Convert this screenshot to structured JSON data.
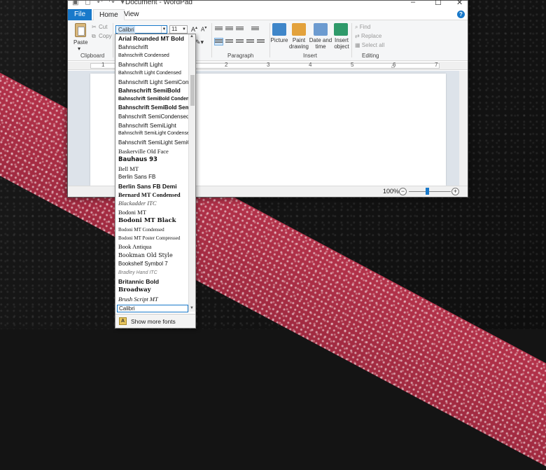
{
  "window": {
    "title": "Document - WordPad",
    "tabs": {
      "file": "File",
      "home": "Home",
      "view": "View"
    },
    "help": "?",
    "controls": {
      "minimize": "–",
      "maximize": "☐",
      "close": "✕"
    }
  },
  "ribbon": {
    "clipboard": {
      "label": "Clipboard",
      "paste": "Paste",
      "cut": "Cut",
      "copy": "Copy"
    },
    "font": {
      "current": "Calibri",
      "size": "11"
    },
    "paragraph": {
      "label": "Paragraph"
    },
    "insert": {
      "label": "Insert",
      "picture": "Picture",
      "paint_drawing": "Paint drawing",
      "date_time": "Date and time",
      "insert_object": "Insert object"
    },
    "editing": {
      "label": "Editing",
      "find": "Find",
      "replace": "Replace",
      "select_all": "Select all"
    }
  },
  "ruler": {
    "marks": [
      "1",
      "2",
      "3",
      "4",
      "5",
      "6",
      "7"
    ]
  },
  "status": {
    "zoom": "100%",
    "zoom_level_percent": 100
  },
  "font_list": {
    "items": [
      "Arial Rounded MT Bold",
      "Bahnschrift",
      "Bahnschrift Condensed",
      "Bahnschrift Light",
      "Bahnschrift Light Condensed",
      "Bahnschrift Light SemiCondensed",
      "Bahnschrift SemiBold",
      "Bahnschrift SemiBold Condensed",
      "Bahnschrift SemiBold SemiConde",
      "Bahnschrift SemiCondensed",
      "Bahnschrift SemiLight",
      "Bahnschrift SemiLight Condensed",
      "Bahnschrift SemiLight SemiConde",
      "Baskerville Old Face",
      "Bauhaus 93",
      "Bell MT",
      "Berlin Sans FB",
      "Berlin Sans FB Demi",
      "Bernard MT Condensed",
      "Blackadder ITC",
      "Bodoni MT",
      "Bodoni MT Black",
      "Bodoni MT Condensed",
      "Bodoni MT Poster Compressed",
      "Book Antiqua",
      "Bookman Old Style",
      "Bookshelf Symbol 7",
      "Bradley Hand ITC",
      "Britannic Bold",
      "Broadway",
      "Brush Script MT"
    ],
    "recent": "Calibri",
    "show_more": "Show more fonts"
  }
}
